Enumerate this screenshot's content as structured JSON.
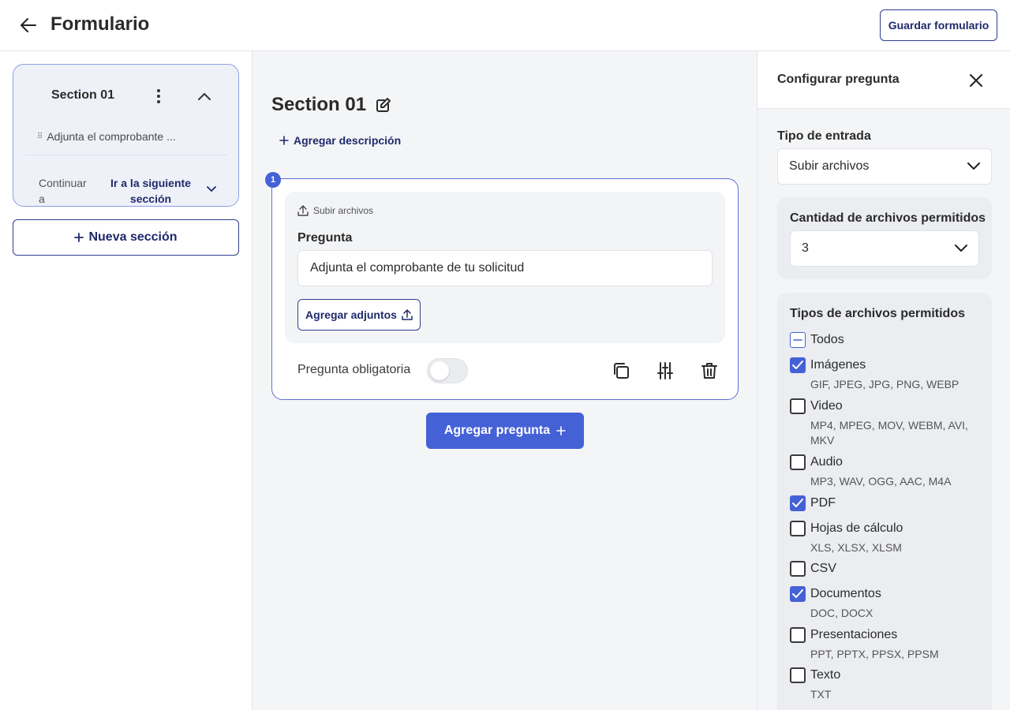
{
  "header": {
    "title": "Formulario",
    "save_label": "Guardar formulario"
  },
  "sidebar": {
    "section_title": "Section 01",
    "question_preview": "Adjunta el comprobante ...",
    "continue_label": "Continuar a",
    "destination": "Ir a la siguiente sección",
    "new_section_label": "Nueva sección"
  },
  "main": {
    "section_title": "Section 01",
    "add_description_label": "Agregar descripción",
    "question": {
      "number": "1",
      "type_label": "Subir archivos",
      "field_label": "Pregunta",
      "value": "Adjunta el comprobante de tu solicitud",
      "attach_label": "Agregar adjuntos",
      "required_label": "Pregunta obligatoria",
      "required": false
    },
    "add_question_label": "Agregar pregunta"
  },
  "config": {
    "title": "Configurar pregunta",
    "input_type_label": "Tipo de entrada",
    "input_type_value": "Subir archivos",
    "file_count_label": "Cantidad de archivos permitidos",
    "file_count_value": "3",
    "file_types_label": "Tipos de archivos permitidos",
    "file_types": [
      {
        "name": "Todos",
        "ext": "",
        "state": "indeterminate"
      },
      {
        "name": "Imágenes",
        "ext": "GIF, JPEG, JPG, PNG, WEBP",
        "state": "checked"
      },
      {
        "name": "Video",
        "ext": "MP4, MPEG, MOV, WEBM, AVI, MKV",
        "state": "unchecked"
      },
      {
        "name": "Audio",
        "ext": "MP3, WAV, OGG, AAC, M4A",
        "state": "unchecked"
      },
      {
        "name": "PDF",
        "ext": "",
        "state": "checked"
      },
      {
        "name": "Hojas de cálculo",
        "ext": "XLS, XLSX, XLSM",
        "state": "unchecked"
      },
      {
        "name": "CSV",
        "ext": "",
        "state": "unchecked"
      },
      {
        "name": "Documentos",
        "ext": "DOC, DOCX",
        "state": "checked"
      },
      {
        "name": "Presentaciones",
        "ext": "PPT, PPTX, PPSX, PPSM",
        "state": "unchecked"
      },
      {
        "name": "Texto",
        "ext": "TXT",
        "state": "unchecked"
      }
    ]
  },
  "colors": {
    "accent": "#4561d6",
    "navy": "#1f2a6b"
  }
}
